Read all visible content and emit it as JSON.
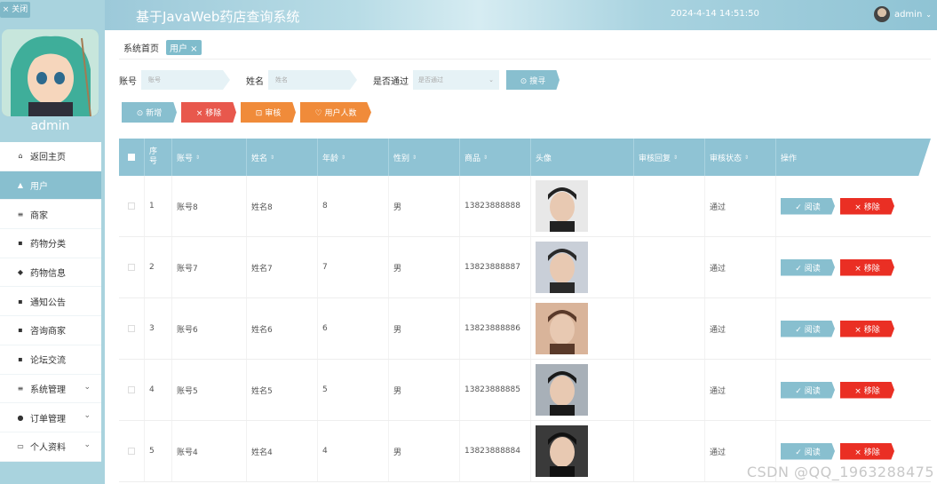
{
  "sidebar": {
    "close_label": "× 关闭",
    "username": "admin",
    "items": [
      {
        "icon": "⌂",
        "label": "返回主页",
        "active": false,
        "chevron": false
      },
      {
        "icon": "▲",
        "label": "用户",
        "active": true,
        "chevron": false
      },
      {
        "icon": "≡",
        "label": "商家",
        "active": false,
        "chevron": false
      },
      {
        "icon": "▪",
        "label": "药物分类",
        "active": false,
        "chevron": false
      },
      {
        "icon": "◆",
        "label": "药物信息",
        "active": false,
        "chevron": false
      },
      {
        "icon": "▪",
        "label": "通知公告",
        "active": false,
        "chevron": false
      },
      {
        "icon": "▪",
        "label": "咨询商家",
        "active": false,
        "chevron": false
      },
      {
        "icon": "▪",
        "label": "论坛交流",
        "active": false,
        "chevron": false
      },
      {
        "icon": "≡",
        "label": "系统管理",
        "active": false,
        "chevron": true
      },
      {
        "icon": "●",
        "label": "订单管理",
        "active": false,
        "chevron": true
      },
      {
        "icon": "▭",
        "label": "个人资料",
        "active": false,
        "chevron": true
      }
    ]
  },
  "header": {
    "title": "基于JavaWeb药店查询系统",
    "datetime": "2024-4-14 14:51:50",
    "user": "admin"
  },
  "breadcrumb": {
    "home": "系统首页",
    "current": "用户 ×"
  },
  "search": {
    "account_label": "账号",
    "account_placeholder": "账号",
    "name_label": "姓名",
    "name_placeholder": "姓名",
    "approved_label": "是否通过",
    "approved_placeholder": "是否通过",
    "search_btn": "⊙ 搜寻"
  },
  "actions": {
    "add": "⊙ 新增",
    "remove": "× 移除",
    "audit": "⊡ 审核",
    "user_count": "♡ 用户人数"
  },
  "table": {
    "headers": [
      "序号",
      "账号",
      "姓名",
      "年龄",
      "性别",
      "商品",
      "头像",
      "审核回复",
      "审核状态",
      "操作"
    ],
    "read_label": "✓ 阅读",
    "remove_label": "× 移除",
    "rows": [
      {
        "idx": "1",
        "account": "账号8",
        "name": "姓名8",
        "age": "8",
        "gender": "男",
        "phone": "13823888888",
        "reply": "",
        "status": "通过"
      },
      {
        "idx": "2",
        "account": "账号7",
        "name": "姓名7",
        "age": "7",
        "gender": "男",
        "phone": "13823888887",
        "reply": "",
        "status": "通过"
      },
      {
        "idx": "3",
        "account": "账号6",
        "name": "姓名6",
        "age": "6",
        "gender": "男",
        "phone": "13823888886",
        "reply": "",
        "status": "通过"
      },
      {
        "idx": "4",
        "account": "账号5",
        "name": "姓名5",
        "age": "5",
        "gender": "男",
        "phone": "13823888885",
        "reply": "",
        "status": "通过"
      },
      {
        "idx": "5",
        "account": "账号4",
        "name": "姓名4",
        "age": "4",
        "gender": "男",
        "phone": "13823888884",
        "reply": "",
        "status": "通过"
      }
    ]
  },
  "watermark": "CSDN @QQ_1963288475"
}
